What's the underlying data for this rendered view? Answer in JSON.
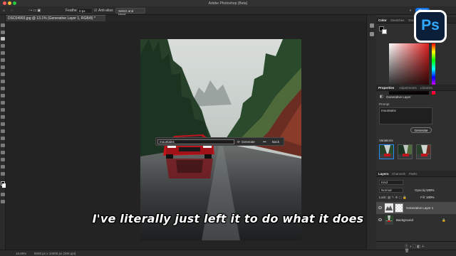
{
  "window": {
    "title": "Adobe Photoshop (Beta)"
  },
  "options_bar": {
    "feather_label": "Feather:",
    "feather_value": "0 px",
    "anti_alias_label": "Anti-alias",
    "select_mask_label": "Select and Mask...",
    "share_label": "Share"
  },
  "document": {
    "tab_title": "DSC04993.jpg @ 13.1% (Generative Layer 1, RGB/8) *",
    "zoom": "16.66%",
    "dimensions": "8000 px x 10000 px (300 ppi)"
  },
  "contextual_taskbar": {
    "prompt_value": "mountains",
    "generate_label": "Generate",
    "more_label": "•••",
    "back_label": "Back"
  },
  "caption": {
    "text": "I've literally just left it to do what it does"
  },
  "panels": {
    "color_tabs": [
      "Color",
      "Swatches",
      "Gra"
    ],
    "properties_tabs": [
      "Properties",
      "Adjustments",
      "Libraries"
    ],
    "layer_type": "Generative Layer",
    "prompt_label": "Prompt",
    "prompt_value": "mountains",
    "generate_label": "Generate",
    "variations_label": "Variations",
    "layers_tabs": [
      "Layers",
      "Channels",
      "Paths"
    ],
    "kind_label": "Kind",
    "blend_mode": "Normal",
    "opacity_label": "Opacity:",
    "opacity_value": "100%",
    "lock_label": "Lock:",
    "fill_label": "Fill:",
    "fill_value": "100%",
    "layers": [
      {
        "name": "Generative Layer 1",
        "selected": true
      },
      {
        "name": "Background",
        "selected": false
      }
    ]
  },
  "badge": {
    "text": "Ps"
  },
  "colors": {
    "accent_blue": "#1473e6",
    "ps_blue": "#31a8ff",
    "ps_navy": "#0b1f3a",
    "car_red": "#c0161b",
    "forest_green": "#2c4a2f"
  }
}
